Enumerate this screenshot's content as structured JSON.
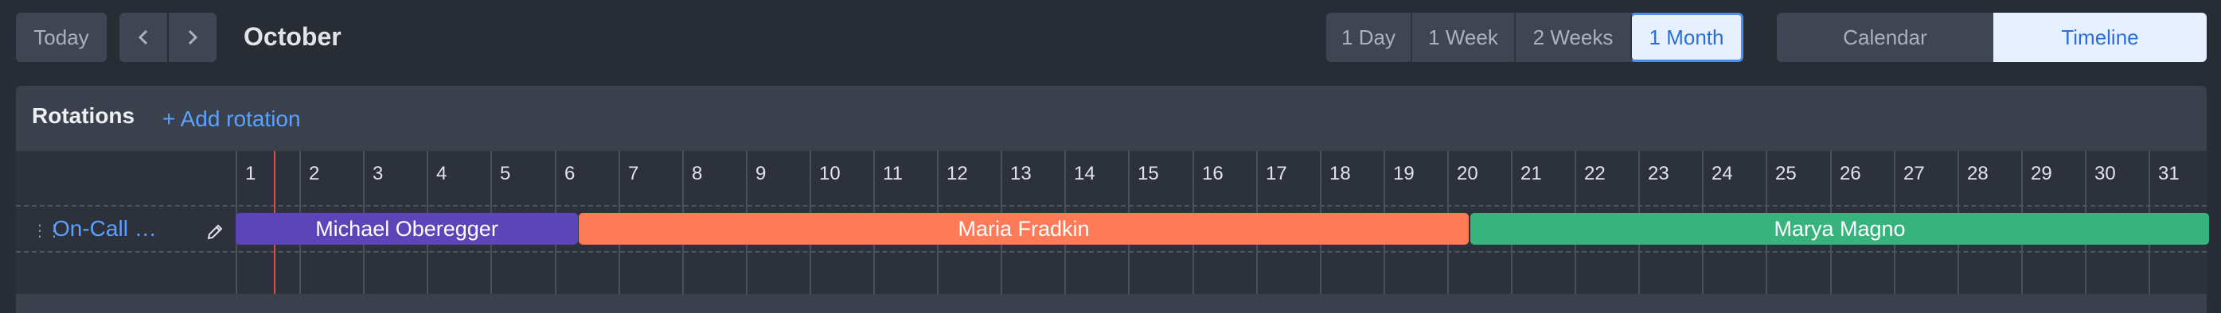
{
  "toolbar": {
    "today_label": "Today",
    "prev_icon": "chevron-left-icon",
    "next_icon": "chevron-right-icon",
    "month_title": "October",
    "range_options": [
      "1 Day",
      "1 Week",
      "2 Weeks",
      "1 Month"
    ],
    "range_selected": "1 Month",
    "view_options": [
      "Calendar",
      "Timeline"
    ],
    "view_selected": "Timeline"
  },
  "rotations": {
    "title": "Rotations",
    "add_label": "+ Add rotation"
  },
  "days": [
    "1",
    "2",
    "3",
    "4",
    "5",
    "6",
    "7",
    "8",
    "9",
    "10",
    "11",
    "12",
    "13",
    "14",
    "15",
    "16",
    "17",
    "18",
    "19",
    "20",
    "21",
    "22",
    "23",
    "24",
    "25",
    "26",
    "27",
    "28",
    "29",
    "30",
    "31"
  ],
  "rotation": {
    "name": "On-Call …",
    "edit_icon": "pencil-icon",
    "drag_icon": "drag-handle-icon",
    "shifts": [
      {
        "person": "Michael Oberegger",
        "color": "#5b45b8"
      },
      {
        "person": "Maria Fradkin",
        "color": "#ff7a57"
      },
      {
        "person": "Marya Magno",
        "color": "#37b37e"
      }
    ]
  },
  "colors": {
    "background": "#282c34",
    "panel": "#3a404c",
    "accent": "#5aa2ff",
    "now_line": "#d2533f"
  }
}
